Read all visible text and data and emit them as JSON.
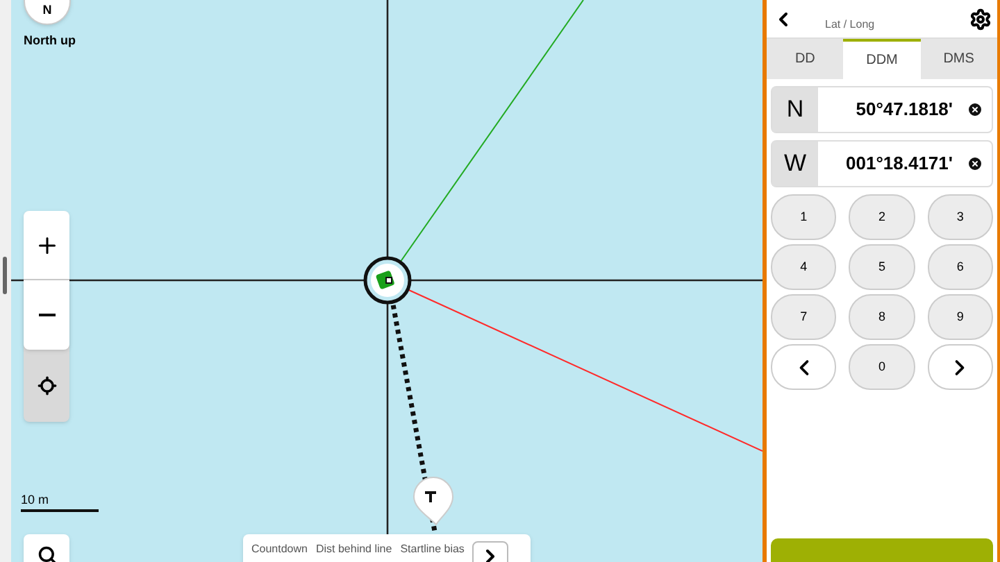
{
  "map": {
    "compass_letter": "N",
    "compass_label": "North up",
    "scale_label": "10 m",
    "info_bar": {
      "labels": [
        "Countdown",
        "Dist behind line",
        "Startline bias"
      ]
    }
  },
  "panel": {
    "subtitle": "Lat / Long",
    "tabs": [
      {
        "label": "DD",
        "selected": false
      },
      {
        "label": "DDM",
        "selected": true
      },
      {
        "label": "DMS",
        "selected": false
      }
    ],
    "coordinates": [
      {
        "hemisphere": "N",
        "value": "50°47.1818'"
      },
      {
        "hemisphere": "W",
        "value": "001°18.4171'"
      }
    ],
    "keys": [
      {
        "label": "1",
        "kind": "digit"
      },
      {
        "label": "2",
        "kind": "digit"
      },
      {
        "label": "3",
        "kind": "digit"
      },
      {
        "label": "4",
        "kind": "digit"
      },
      {
        "label": "5",
        "kind": "digit"
      },
      {
        "label": "6",
        "kind": "digit"
      },
      {
        "label": "7",
        "kind": "digit"
      },
      {
        "label": "8",
        "kind": "digit"
      },
      {
        "label": "9",
        "kind": "digit"
      },
      {
        "kind": "left"
      },
      {
        "label": "0",
        "kind": "digit"
      },
      {
        "kind": "right"
      }
    ]
  }
}
